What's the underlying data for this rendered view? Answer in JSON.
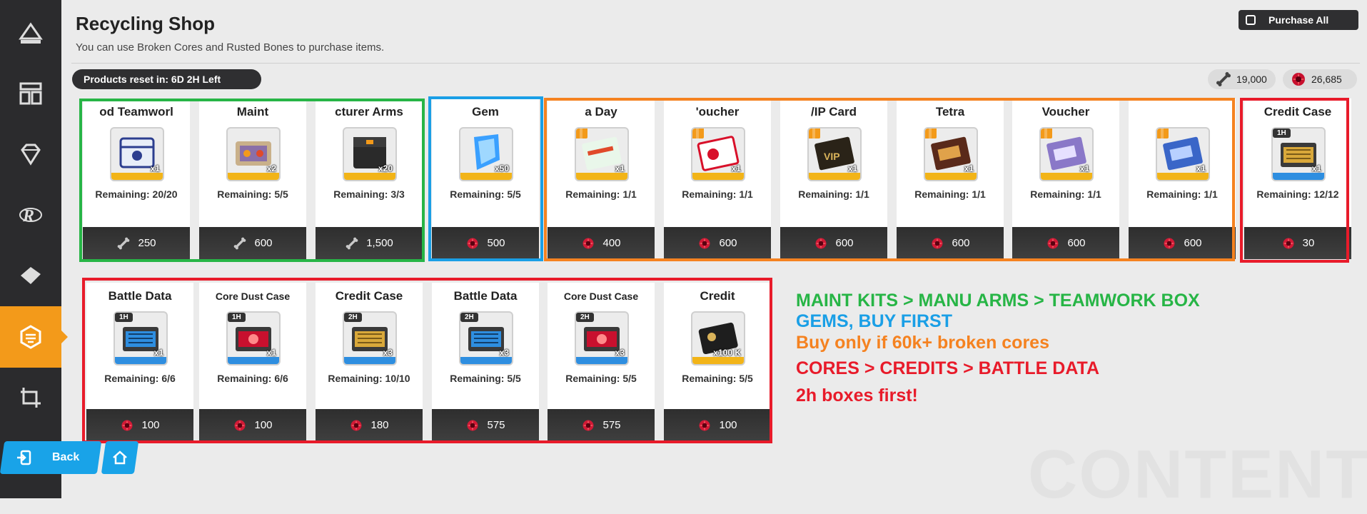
{
  "header": {
    "title": "Recycling Shop",
    "subtitle": "You can use Broken Cores and Rusted Bones to purchase items.",
    "purchase_all_label": "Purchase All",
    "reset_label": "Products reset in: 6D 2H Left"
  },
  "currencies": [
    {
      "icon": "rusted-bone-icon",
      "value": "19,000"
    },
    {
      "icon": "broken-core-icon",
      "value": "26,685"
    }
  ],
  "sidebar": {
    "items": [
      {
        "icon": "anvil-icon",
        "active": false
      },
      {
        "icon": "layout-icon",
        "active": false
      },
      {
        "icon": "diamond-icon",
        "active": false
      },
      {
        "icon": "r-logo-icon",
        "active": false
      },
      {
        "icon": "ticket-icon",
        "active": false
      },
      {
        "icon": "recycle-hex-icon",
        "active": true
      },
      {
        "icon": "crop-icon",
        "active": false
      }
    ]
  },
  "shop": {
    "row1": [
      {
        "name": "od Teamworl",
        "qty": "x1",
        "remaining": "Remaining: 20/20",
        "price": "250",
        "currency": "bone",
        "art": "teamwork-box"
      },
      {
        "name": "Maint",
        "qty": "x2",
        "remaining": "Remaining: 5/5",
        "price": "600",
        "currency": "bone",
        "art": "maint-kit"
      },
      {
        "name": "cturer Arms",
        "qty": "x20",
        "remaining": "Remaining: 3/3",
        "price": "1,500",
        "currency": "bone",
        "art": "arms-box"
      },
      {
        "name": "Gem",
        "qty": "x50",
        "remaining": "Remaining: 5/5",
        "price": "500",
        "currency": "core",
        "art": "gem"
      },
      {
        "name": "a Day",
        "qty": "x1",
        "remaining": "Remaining: 1/1",
        "price": "400",
        "currency": "core",
        "art": "voucher-green"
      },
      {
        "name": "'oucher",
        "qty": "x1",
        "remaining": "Remaining: 1/1",
        "price": "600",
        "currency": "core",
        "art": "voucher-red"
      },
      {
        "name": "/IP Card",
        "qty": "x1",
        "remaining": "Remaining: 1/1",
        "price": "600",
        "currency": "core",
        "art": "vip-card"
      },
      {
        "name": "Tetra",
        "qty": "x1",
        "remaining": "Remaining: 1/1",
        "price": "600",
        "currency": "core",
        "art": "voucher-brown"
      },
      {
        "name": "Voucher",
        "qty": "x1",
        "remaining": "Remaining: 1/1",
        "price": "600",
        "currency": "core",
        "art": "voucher-purple"
      },
      {
        "name": "",
        "qty": "x1",
        "remaining": "Remaining: 1/1",
        "price": "600",
        "currency": "core",
        "art": "voucher-blue"
      },
      {
        "name": "Credit Case",
        "qty": "x1",
        "tag": "1H",
        "remaining": "Remaining: 12/12",
        "price": "30",
        "currency": "core",
        "art": "credit-case"
      }
    ],
    "row2": [
      {
        "name": "Battle Data",
        "qty": "x1",
        "tag": "1H",
        "remaining": "Remaining: 6/6",
        "price": "100",
        "currency": "core",
        "art": "battle-data"
      },
      {
        "name": "Core Dust Case",
        "qty": "x1",
        "tag": "1H",
        "remaining": "Remaining: 6/6",
        "price": "100",
        "currency": "core",
        "art": "core-dust"
      },
      {
        "name": "Credit Case",
        "qty": "x3",
        "tag": "2H",
        "remaining": "Remaining: 10/10",
        "price": "180",
        "currency": "core",
        "art": "credit-case"
      },
      {
        "name": "Battle Data",
        "qty": "x3",
        "tag": "2H",
        "remaining": "Remaining: 5/5",
        "price": "575",
        "currency": "core",
        "art": "battle-data"
      },
      {
        "name": "Core Dust Case",
        "qty": "x3",
        "tag": "2H",
        "remaining": "Remaining: 5/5",
        "price": "575",
        "currency": "core",
        "art": "core-dust"
      },
      {
        "name": "Credit",
        "qty": "x100 K",
        "remaining": "Remaining: 5/5",
        "price": "100",
        "currency": "core",
        "art": "credit-card"
      }
    ]
  },
  "annotations": [
    {
      "text": "MAINT KITS > MANU ARMS > TEAMWORK BOX",
      "color": "#27b546"
    },
    {
      "text": "GEMS, BUY FIRST",
      "color": "#1a9fe6"
    },
    {
      "text": "Buy only if 60k+ broken cores",
      "color": "#f58220"
    },
    {
      "text": "CORES > CREDITS > BATTLE DATA",
      "color": "#e81b2a"
    },
    {
      "text": "2h boxes first!",
      "color": "#e81b2a"
    }
  ],
  "footer": {
    "back_label": "Back",
    "watermark": "CONTENT"
  }
}
